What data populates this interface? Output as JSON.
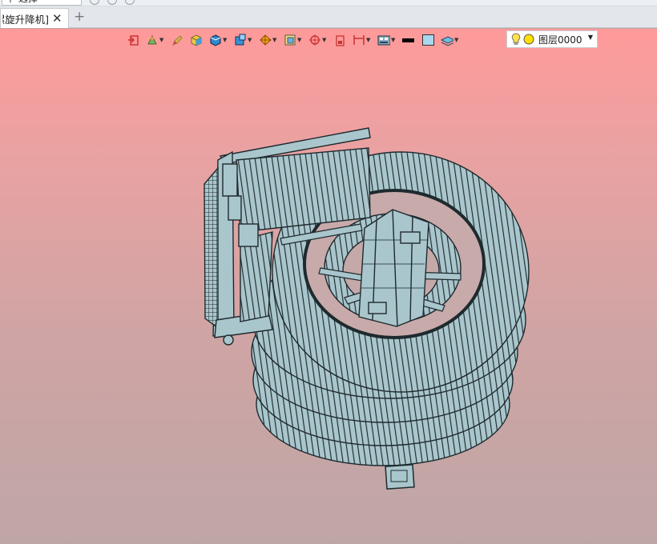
{
  "toolbar": {
    "select_label_a": "中",
    "select_label_b": "选择"
  },
  "tabs": [
    {
      "label": "[螺旋升降机]"
    }
  ],
  "hud": {
    "layer_label": "图层0000"
  },
  "colors": {
    "viewport_top": "#ff9a9a",
    "viewport_bottom": "#bfa6a6",
    "model_fill": "#a9c6cc",
    "model_edge": "#1e2a2e"
  },
  "icons": [
    "exit-icon",
    "orientation-icon",
    "pencil-icon",
    "box-render-icon",
    "box-view-icon",
    "view-cube-icon",
    "explode-icon",
    "section-icon",
    "pivot-icon",
    "measure-icon",
    "dimension-icon",
    "display-mode-icon",
    "line-color-icon",
    "fill-color-icon",
    "layer-icon",
    "bulb-icon"
  ]
}
